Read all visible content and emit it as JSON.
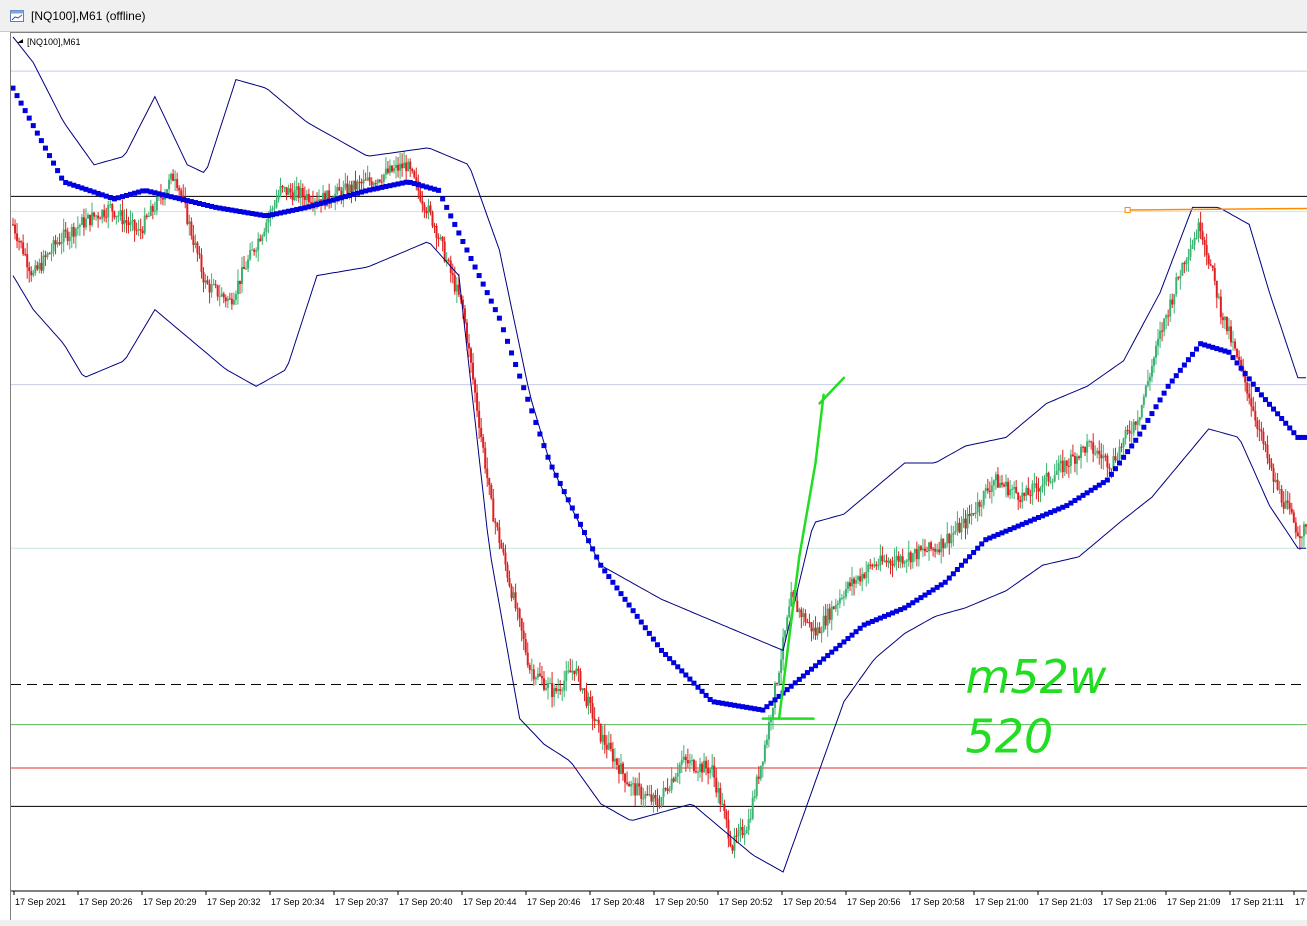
{
  "window": {
    "title": "[NQ100],M61 (offline)",
    "icon": "chart-window-icon"
  },
  "chart_data": {
    "type": "candlestick",
    "symbol_label": "[NQ100],M61",
    "x_tick_labels": [
      "17 Sep 2021",
      "17 Sep 20:26",
      "17 Sep 20:29",
      "17 Sep 20:32",
      "17 Sep 20:34",
      "17 Sep 20:37",
      "17 Sep 20:40",
      "17 Sep 20:44",
      "17 Sep 20:46",
      "17 Sep 20:48",
      "17 Sep 20:50",
      "17 Sep 20:52",
      "17 Sep 20:54",
      "17 Sep 20:56",
      "17 Sep 20:58",
      "17 Sep 21:00",
      "17 Sep 21:03",
      "17 Sep 21:06",
      "17 Sep 21:09",
      "17 Sep 21:11",
      "17 Sep 21:1"
    ],
    "y_range": [
      0,
      100
    ],
    "price_path": [
      [
        0,
        78
      ],
      [
        10,
        72
      ],
      [
        22,
        76
      ],
      [
        33,
        78
      ],
      [
        48,
        80
      ],
      [
        62,
        77
      ],
      [
        80,
        84
      ],
      [
        95,
        71
      ],
      [
        107,
        69
      ],
      [
        132,
        82
      ],
      [
        154,
        81
      ],
      [
        175,
        83
      ],
      [
        194,
        85
      ],
      [
        208,
        78
      ],
      [
        222,
        68
      ],
      [
        236,
        45
      ],
      [
        255,
        26
      ],
      [
        267,
        23
      ],
      [
        277,
        26
      ],
      [
        290,
        18
      ],
      [
        305,
        12
      ],
      [
        318,
        10
      ],
      [
        330,
        15
      ],
      [
        345,
        14
      ],
      [
        355,
        5
      ],
      [
        363,
        8
      ],
      [
        372,
        18
      ],
      [
        384,
        34
      ],
      [
        396,
        30
      ],
      [
        410,
        35
      ],
      [
        424,
        38
      ],
      [
        440,
        39
      ],
      [
        455,
        40
      ],
      [
        470,
        43
      ],
      [
        484,
        48
      ],
      [
        499,
        46
      ],
      [
        515,
        49
      ],
      [
        530,
        52
      ],
      [
        542,
        50
      ],
      [
        556,
        56
      ],
      [
        566,
        65
      ],
      [
        578,
        74
      ],
      [
        586,
        78
      ],
      [
        596,
        68
      ],
      [
        610,
        58
      ],
      [
        622,
        48
      ],
      [
        634,
        42
      ]
    ],
    "candle_count": 640,
    "ma_path": [
      [
        0,
        94
      ],
      [
        25,
        83
      ],
      [
        50,
        81
      ],
      [
        65,
        82
      ],
      [
        100,
        80
      ],
      [
        125,
        79
      ],
      [
        145,
        80
      ],
      [
        175,
        82
      ],
      [
        195,
        83
      ],
      [
        210,
        82
      ],
      [
        240,
        67
      ],
      [
        265,
        50
      ],
      [
        290,
        38
      ],
      [
        320,
        28
      ],
      [
        345,
        22
      ],
      [
        370,
        21
      ],
      [
        395,
        26
      ],
      [
        420,
        31
      ],
      [
        440,
        33
      ],
      [
        460,
        36
      ],
      [
        480,
        41
      ],
      [
        500,
        43
      ],
      [
        520,
        45
      ],
      [
        540,
        48
      ],
      [
        555,
        53
      ],
      [
        570,
        59
      ],
      [
        586,
        64
      ],
      [
        600,
        63
      ],
      [
        616,
        58
      ],
      [
        634,
        53
      ]
    ],
    "band_upper_path": [
      [
        0,
        100
      ],
      [
        10,
        97
      ],
      [
        25,
        90
      ],
      [
        40,
        85
      ],
      [
        55,
        86
      ],
      [
        70,
        93
      ],
      [
        86,
        85
      ],
      [
        95,
        84
      ],
      [
        110,
        95
      ],
      [
        125,
        94
      ],
      [
        145,
        90
      ],
      [
        175,
        86
      ],
      [
        205,
        87
      ],
      [
        225,
        85
      ],
      [
        240,
        75
      ],
      [
        255,
        58
      ],
      [
        265,
        50
      ],
      [
        275,
        45
      ],
      [
        290,
        38
      ],
      [
        320,
        34
      ],
      [
        340,
        32
      ],
      [
        360,
        30
      ],
      [
        380,
        28
      ],
      [
        395,
        43
      ],
      [
        410,
        44
      ],
      [
        425,
        47
      ],
      [
        440,
        50
      ],
      [
        455,
        50
      ],
      [
        470,
        52
      ],
      [
        490,
        53
      ],
      [
        510,
        57
      ],
      [
        530,
        59
      ],
      [
        548,
        62
      ],
      [
        566,
        70
      ],
      [
        582,
        80
      ],
      [
        595,
        80
      ],
      [
        610,
        78
      ],
      [
        620,
        70
      ],
      [
        634,
        60
      ]
    ],
    "band_lower_path": [
      [
        0,
        72
      ],
      [
        10,
        68
      ],
      [
        25,
        64
      ],
      [
        35,
        60
      ],
      [
        55,
        62
      ],
      [
        70,
        68
      ],
      [
        85,
        65
      ],
      [
        105,
        61
      ],
      [
        120,
        59
      ],
      [
        135,
        61
      ],
      [
        150,
        72
      ],
      [
        175,
        73
      ],
      [
        205,
        76
      ],
      [
        220,
        72
      ],
      [
        235,
        40
      ],
      [
        250,
        20
      ],
      [
        262,
        17
      ],
      [
        275,
        15
      ],
      [
        290,
        10
      ],
      [
        305,
        8
      ],
      [
        320,
        9
      ],
      [
        335,
        10
      ],
      [
        350,
        7
      ],
      [
        365,
        4
      ],
      [
        380,
        2
      ],
      [
        395,
        12
      ],
      [
        410,
        22
      ],
      [
        425,
        27
      ],
      [
        440,
        30
      ],
      [
        455,
        32
      ],
      [
        470,
        33
      ],
      [
        490,
        35
      ],
      [
        508,
        38
      ],
      [
        526,
        39
      ],
      [
        546,
        43
      ],
      [
        562,
        46
      ],
      [
        576,
        50
      ],
      [
        590,
        54
      ],
      [
        605,
        53
      ],
      [
        620,
        45
      ],
      [
        634,
        40
      ]
    ],
    "horizontal_levels": [
      {
        "value": 96.0,
        "style": "solid",
        "color": "#c8cce8"
      },
      {
        "value": 81.3,
        "style": "solid",
        "color": "#000000"
      },
      {
        "value": 79.5,
        "style": "solid",
        "color": "#c8e8d8"
      },
      {
        "value": 59.2,
        "style": "solid",
        "color": "#c8cce8"
      },
      {
        "value": 40.0,
        "style": "solid",
        "color": "#c8e8d8"
      },
      {
        "value": 24.0,
        "style": "dashed",
        "color": "#000000"
      },
      {
        "value": 19.3,
        "style": "solid",
        "color": "#5ab45a"
      },
      {
        "value": 14.2,
        "style": "solid",
        "color": "#e03030"
      },
      {
        "value": 9.7,
        "style": "solid",
        "color": "#000000"
      }
    ],
    "resistance_line": {
      "x_start": 550,
      "x_end": 640,
      "value": 79.7,
      "color": "#ff8c00"
    },
    "annotations": {
      "text_line1": "m52w",
      "text_line2": "520",
      "color": "#22dd22"
    },
    "colors": {
      "bull": "#3cb371",
      "bear": "#e02020",
      "ma": "#0000e0",
      "bands": "#000080",
      "background": "#ffffff"
    }
  }
}
